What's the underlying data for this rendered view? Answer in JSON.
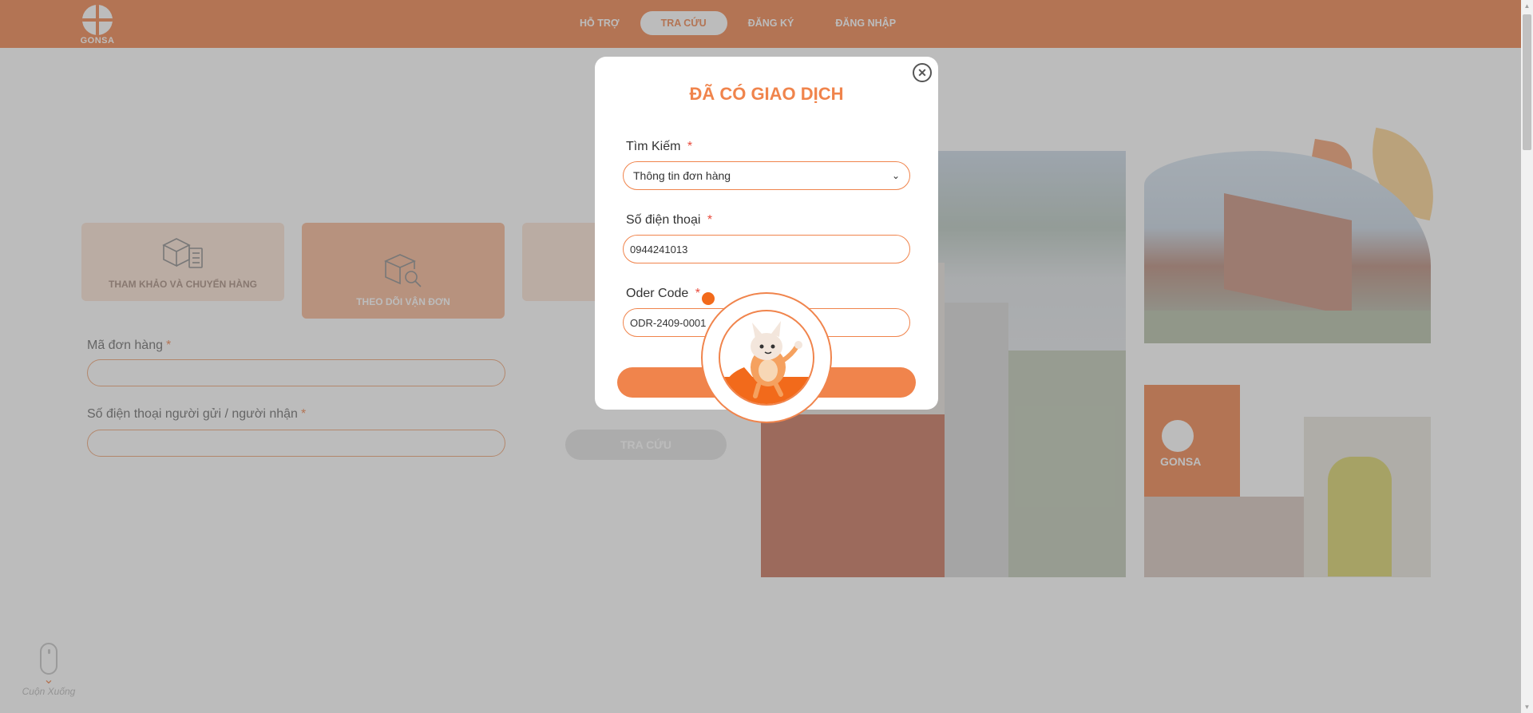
{
  "header": {
    "logo_text": "GONSA",
    "nav": [
      {
        "label": "HỖ TRỢ",
        "active": false
      },
      {
        "label": "TRA CỨU",
        "active": true
      },
      {
        "label": "ĐĂNG KÝ",
        "active": false
      },
      {
        "label": "ĐĂNG NHẬP",
        "active": false
      }
    ]
  },
  "tabs": [
    {
      "label": "THAM KHẢO VÀ CHUYỂN HÀNG",
      "icon": "boxes-checklist-icon"
    },
    {
      "label": "THEO DÕI VẬN ĐƠN",
      "icon": "box-search-icon"
    }
  ],
  "form": {
    "order_code_label": "Mã đơn hàng",
    "phone_label": "Số điện thoại người gửi / người nhận",
    "required_mark": "*",
    "submit_label": "TRA CỨU"
  },
  "scroll_hint": {
    "label": "Cuộn Xuống"
  },
  "photo_logo": "GONSA",
  "modal": {
    "title": "ĐÃ CÓ GIAO DỊCH",
    "search_label": "Tìm Kiếm",
    "search_value": "Thông tin đơn hàng",
    "phone_label": "Số điện thoại",
    "phone_value": "0944241013",
    "order_code_label": "Oder Code",
    "order_code_value": "ODR-2409-0001",
    "required_mark": "*"
  },
  "colors": {
    "brand_orange": "#f0844c",
    "overlay": "rgba(95,95,95,0.42)"
  }
}
